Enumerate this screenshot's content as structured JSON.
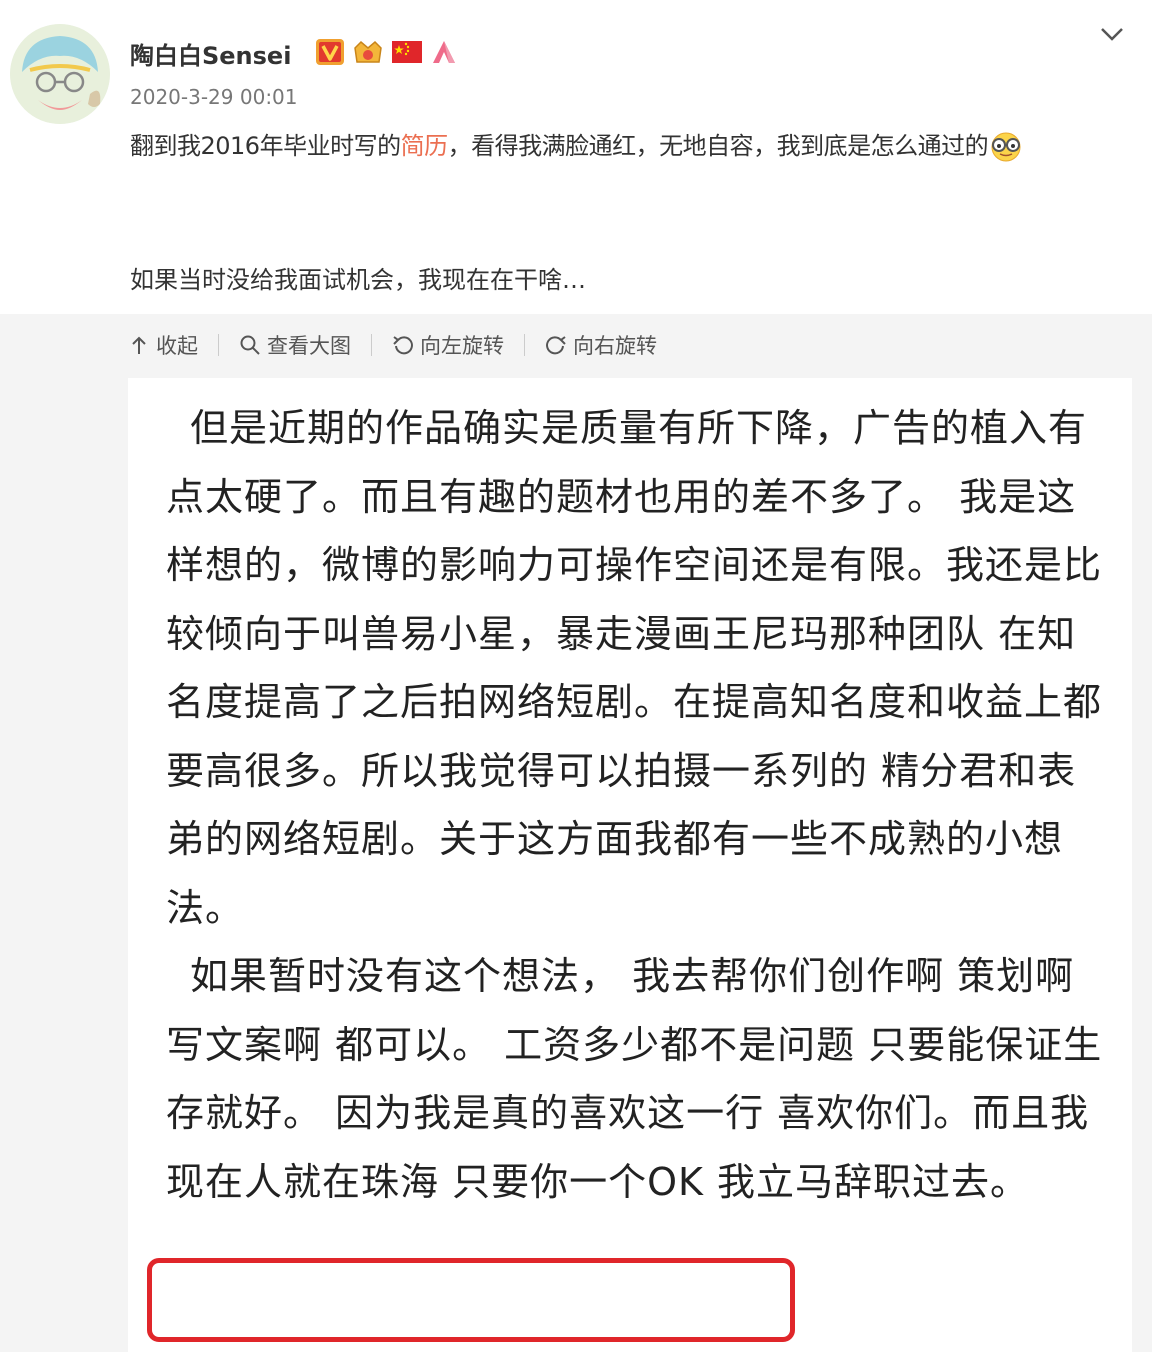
{
  "post": {
    "author_name": "陶白白Sensei",
    "timestamp": "2020-3-29 00:01",
    "text_part1": "翻到我2016年毕业时写的",
    "text_highlight": "简历",
    "text_part2": "，看得我满脸通红，无地自容，我到底是怎么通过的",
    "text_line2": "如果当时没给我面试机会，我现在在干啥…",
    "icons": [
      "avatar",
      "verified-v-badge",
      "crown-badge",
      "china-flag-badge",
      "vip-a-badge",
      "chevron-down-icon",
      "nerd-face-emoji"
    ],
    "colors": {
      "highlight": "#eb6f51",
      "verified_v": "#f0a030",
      "red_box": "#e0262a"
    }
  },
  "toolbar": {
    "collapse_label": "收起",
    "view_large_label": "查看大图",
    "rotate_left_label": "向左旋转",
    "rotate_right_label": "向右旋转"
  },
  "image_content": {
    "paragraph1": "但是近期的作品确实是质量有所下降，广告的植入有点太硬了。而且有趣的题材也用的差不多了。 我是这样想的，微博的影响力可操作空间还是有限。我还是比较倾向于叫兽易小星，暴走漫画王尼玛那种团队 在知名度提高了之后拍网络短剧。在提高知名度和收益上都要高很多。所以我觉得可以拍摄一系列的 精分君和表弟的网络短剧。关于这方面我都有一些不成熟的小想法。",
    "paragraph2": "如果暂时没有这个想法， 我去帮你们创作啊 策划啊 写文案啊 都可以。 工资多少都不是问题 只要能保证生存就好。 因为我是真的喜欢这一行 喜欢你们。而且我现在人就在珠海 只要你一个OK 我立马辞职过去。"
  }
}
